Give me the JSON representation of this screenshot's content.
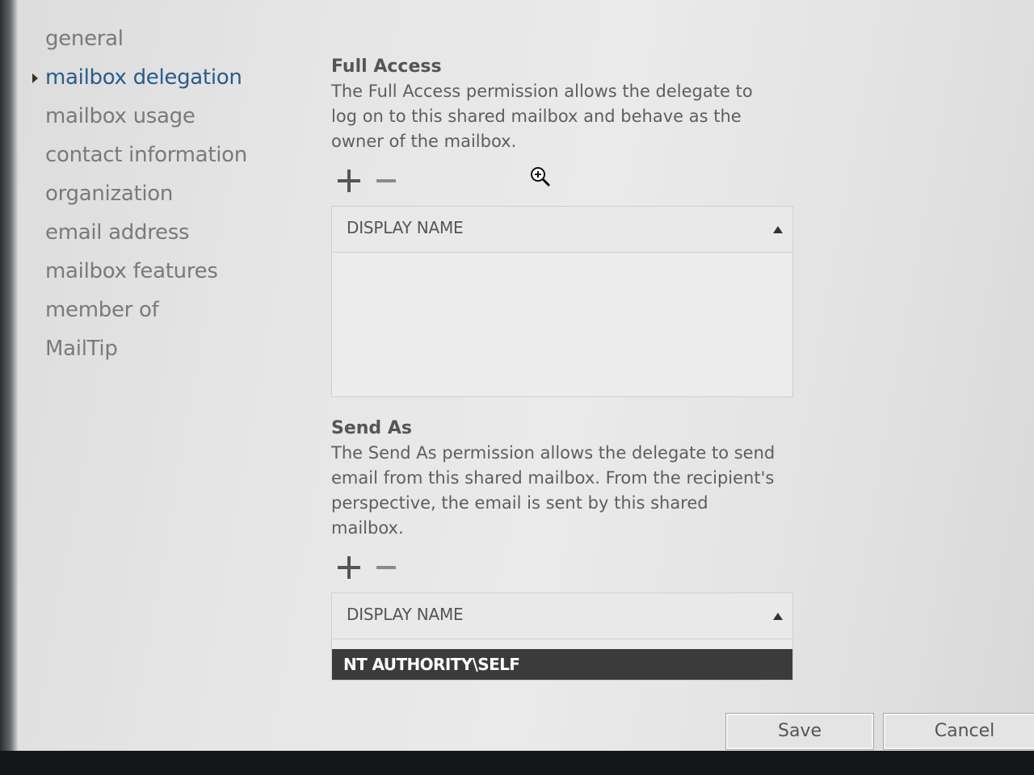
{
  "nav": {
    "items": [
      {
        "label": "general",
        "selected": false
      },
      {
        "label": "mailbox delegation",
        "selected": true
      },
      {
        "label": "mailbox usage",
        "selected": false
      },
      {
        "label": "contact information",
        "selected": false
      },
      {
        "label": "organization",
        "selected": false
      },
      {
        "label": "email address",
        "selected": false
      },
      {
        "label": "mailbox features",
        "selected": false
      },
      {
        "label": "member of",
        "selected": false
      },
      {
        "label": "MailTip",
        "selected": false
      }
    ]
  },
  "full_access": {
    "title": "Full Access",
    "description": "The Full Access permission allows the delegate to log on to this shared mailbox and behave as the owner of the mailbox.",
    "column_header": "DISPLAY NAME",
    "rows": []
  },
  "send_as": {
    "title": "Send As",
    "description": "The Send As permission allows the delegate to send email from this shared mailbox. From the recipient's perspective, the email is sent by this shared mailbox.",
    "column_header": "DISPLAY NAME",
    "rows": [
      "NT AUTHORITY\\SELF"
    ]
  },
  "footer": {
    "save_label": "Save",
    "cancel_label": "Cancel"
  },
  "colors": {
    "selected_nav": "#2a5b8c",
    "nav_text": "#7a7a7a",
    "selected_row_bg": "#3b3b3b"
  },
  "icons": [
    "plus-icon",
    "minus-icon",
    "sort-ascending-icon",
    "zoom-in-cursor-icon",
    "chevron-right-icon"
  ]
}
